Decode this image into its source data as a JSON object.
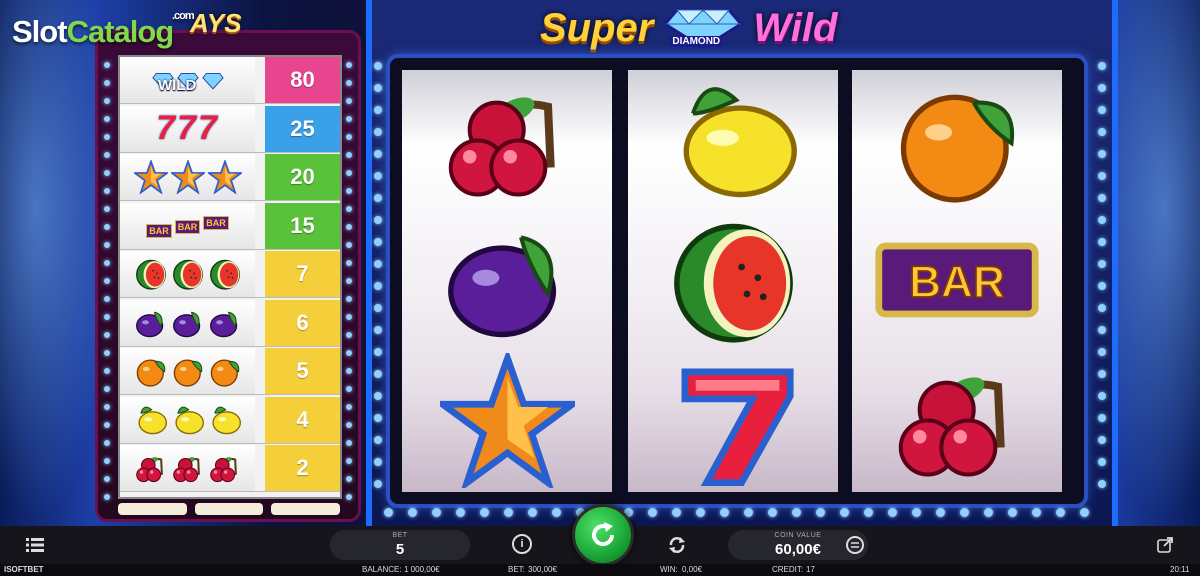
{
  "watermark": {
    "part1": "Slot",
    "part2": "Catalog",
    "suffix": ".com"
  },
  "game": {
    "title_left": "Super",
    "title_badge": "DIAMOND",
    "title_right": "Wild",
    "paytable_logo": "AYS"
  },
  "paytable": [
    {
      "symbol": "diamond-wild",
      "label": "WILD",
      "payout": "80",
      "color": "#e8458f"
    },
    {
      "symbol": "seven",
      "label": "777",
      "payout": "25",
      "color": "#3aa0e8"
    },
    {
      "symbol": "star",
      "label": "",
      "payout": "20",
      "color": "#59c23a"
    },
    {
      "symbol": "bar",
      "label": "BAR",
      "payout": "15",
      "color": "#59c23a"
    },
    {
      "symbol": "watermelon",
      "label": "",
      "payout": "7",
      "color": "#f4cf3a"
    },
    {
      "symbol": "plum",
      "label": "",
      "payout": "6",
      "color": "#f4cf3a"
    },
    {
      "symbol": "orange",
      "label": "",
      "payout": "5",
      "color": "#f4cf3a"
    },
    {
      "symbol": "lemon",
      "label": "",
      "payout": "4",
      "color": "#f4cf3a"
    },
    {
      "symbol": "cherry",
      "label": "",
      "payout": "2",
      "color": "#f4cf3a"
    }
  ],
  "reels": [
    [
      "cherry",
      "plum",
      "star"
    ],
    [
      "lemon",
      "watermelon",
      "seven"
    ],
    [
      "orange",
      "bar",
      "cherry"
    ]
  ],
  "reel_bar_label": "BAR",
  "controls": {
    "bet_label": "BET",
    "bet_value": "5",
    "coin_value_label": "COIN VALUE",
    "coin_value": "60,00€"
  },
  "status": {
    "brand": "ISOFTBET",
    "balance_label": "BALANCE:",
    "balance_value": "1 000,00€",
    "bet_label": "BET:",
    "bet_value": "300,00€",
    "win_label": "WIN:",
    "win_value": "0,00€",
    "credit_label": "CREDIT:",
    "credit_value": "17",
    "time": "20:11"
  },
  "colors": {
    "spin": "#1faa3a",
    "lamp": "#8fd0ff",
    "frame": "#1d6cff"
  }
}
